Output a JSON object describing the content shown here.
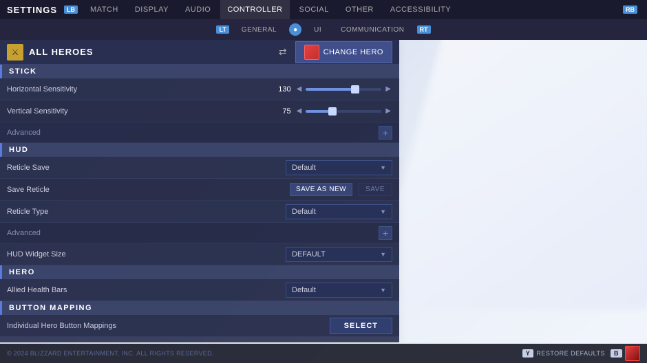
{
  "topNav": {
    "title": "SETTINGS",
    "badgeLeft": "LB",
    "badgeRight": "RB",
    "tabs": [
      {
        "label": "MATCH",
        "active": false
      },
      {
        "label": "DISPLAY",
        "active": false
      },
      {
        "label": "AUDIO",
        "active": false
      },
      {
        "label": "CONTROLLER",
        "active": true
      },
      {
        "label": "SOCIAL",
        "active": false
      },
      {
        "label": "OTHER",
        "active": false
      },
      {
        "label": "ACCESSIBILITY",
        "active": false
      }
    ]
  },
  "subNav": {
    "badgeLeft": "LT",
    "badgeRight": "RT",
    "items": [
      {
        "label": "GENERAL",
        "active": false
      },
      {
        "label": "UI",
        "active": false
      },
      {
        "label": "COMMUNICATION",
        "active": false
      }
    ]
  },
  "hero": {
    "name": "ALL HEROES",
    "changeBtnLabel": "CHANGE HERO"
  },
  "sections": {
    "stick": {
      "header": "STICK",
      "rows": [
        {
          "label": "Horizontal Sensitivity",
          "value": "130",
          "sliderPercent": 65
        },
        {
          "label": "Vertical Sensitivity",
          "value": "75",
          "sliderPercent": 35
        }
      ],
      "advanced": "Advanced"
    },
    "hud": {
      "header": "HUD",
      "reticleSave": {
        "label": "Reticle Save",
        "value": "Default"
      },
      "saveReticle": {
        "label": "Save Reticle",
        "saveAsNewLabel": "SAVE AS NEW",
        "saveLabel": "SAVE"
      },
      "reticleType": {
        "label": "Reticle Type",
        "value": "Default"
      },
      "advanced": "Advanced",
      "hudWidgetSize": {
        "label": "HUD Widget Size",
        "value": "DEFAULT"
      }
    },
    "hero": {
      "header": "HERO",
      "alliedHealthBars": {
        "label": "Allied Health Bars",
        "value": "Default"
      }
    },
    "buttonMapping": {
      "header": "BUTTON MAPPING",
      "row": {
        "label": "Individual Hero Button Mappings",
        "btnLabel": "SELECT"
      }
    }
  },
  "bottomBar": {
    "hint": "© 2024 BLIZZARD ENTERTAINMENT, INC. ALL RIGHTS RESERVED.",
    "actions": [
      {
        "badge": "Y",
        "label": "RESTORE DEFAULTS"
      },
      {
        "badge": "B",
        "label": ""
      }
    ]
  }
}
